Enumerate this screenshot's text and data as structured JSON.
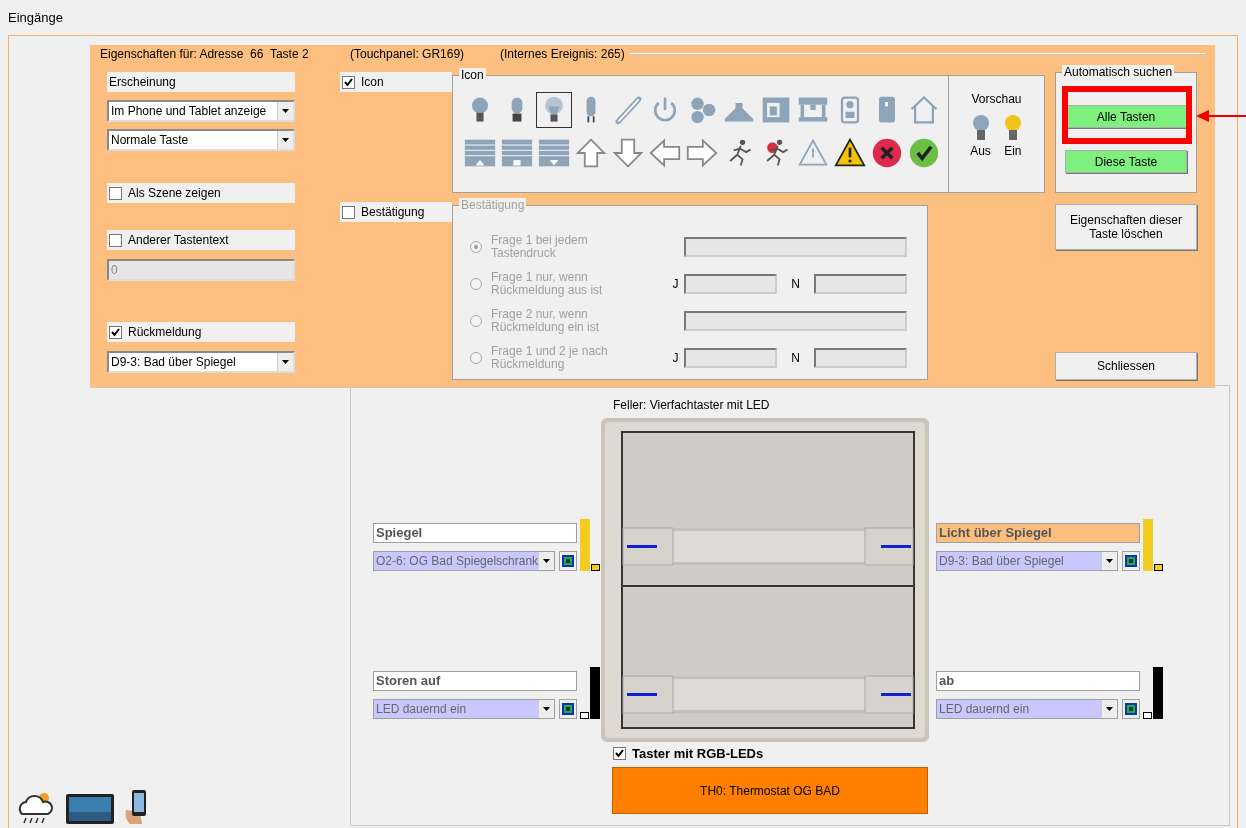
{
  "window": {
    "title": "Eingänge"
  },
  "dialog": {
    "header": [
      "Eigenschaften für: Adresse  66  Taste 2",
      "(Touchpanel: GR169)",
      "(Internes Ereignis: 265)"
    ],
    "appearance": {
      "label": "Erscheinung",
      "display": "Im Phone und Tablet anzeige",
      "type": "Normale Taste"
    },
    "show_as_scene": {
      "label": "Als Szene zeigen",
      "checked": false
    },
    "other_text": {
      "label": "Anderer Tastentext",
      "checked": false,
      "value": "0"
    },
    "feedback": {
      "label": "Rückmeldung",
      "checked": true,
      "source": "D9-3: Bad über Spiegel"
    },
    "icon_toggle": {
      "label": "Icon",
      "checked": true
    },
    "icon_group": {
      "legend": "Icon",
      "icons": [
        {
          "selected": false
        },
        {
          "selected": false
        },
        {
          "selected": true
        },
        {
          "selected": false
        },
        {
          "selected": false
        },
        {
          "selected": false
        },
        {
          "selected": false
        },
        {
          "selected": false
        },
        {
          "selected": false
        },
        {
          "selected": false
        },
        {
          "selected": false
        },
        {
          "selected": false
        },
        {
          "selected": false
        },
        {
          "selected": false
        },
        {
          "selected": false
        },
        {
          "selected": false
        },
        {
          "selected": false
        },
        {
          "selected": false
        },
        {
          "selected": false
        },
        {
          "selected": false
        },
        {
          "selected": false
        },
        {
          "selected": false
        },
        {
          "selected": false
        },
        {
          "selected": false
        },
        {
          "selected": false
        },
        {
          "selected": false
        }
      ]
    },
    "preview": {
      "title": "Vorschau",
      "off": "Aus",
      "on": "Ein"
    },
    "confirm_toggle": {
      "label": "Bestätigung",
      "checked": false
    },
    "confirm_group": {
      "legend": "Bestätigung",
      "disabled": true,
      "options": [
        {
          "label": "Frage 1 bei jedem\nTastendruck",
          "selected": true,
          "kind": "single"
        },
        {
          "label": "Frage 1 nur, wenn\nRückmeldung aus ist",
          "selected": false,
          "kind": "yes_no",
          "yes": "J",
          "no": "N"
        },
        {
          "label": "Frage 2 nur, wenn\nRückmeldung ein ist",
          "selected": false,
          "kind": "single"
        },
        {
          "label": "Frage 1 und 2 je nach\nRückmeldung",
          "selected": false,
          "kind": "yes_no",
          "yes": "J",
          "no": "N"
        }
      ]
    },
    "auto_search": {
      "legend": "Automatisch suchen",
      "buttons": [
        "Alle Tasten",
        "Diese Taste"
      ]
    },
    "delete_button": "Eigenschaften dieser\nTaste löschen",
    "close_button": "Schliessen"
  },
  "device": {
    "caption": "Feller: Vierfachtaster mit LED",
    "keys": [
      {
        "label": "Spiegel",
        "highlighted": false,
        "source": "O2-6: OG Bad Spiegelschrank",
        "led_on": true,
        "color": "#f2cc1f"
      },
      {
        "label": "Licht über Spiegel",
        "highlighted": true,
        "source": "D9-3: Bad über Spiegel",
        "led_on": true,
        "color": "#f2cc1f"
      },
      {
        "label": "Storen auf",
        "highlighted": false,
        "source": "LED dauernd ein",
        "led_on": false,
        "color": "#000000"
      },
      {
        "label": "ab",
        "highlighted": false,
        "source": "LED dauernd ein",
        "led_on": false,
        "color": "#000000"
      }
    ],
    "rgb_toggle": {
      "label": "Taster mit RGB-LEDs",
      "checked": true
    },
    "assigned_button": "TH0: Thermostat OG BAD"
  }
}
